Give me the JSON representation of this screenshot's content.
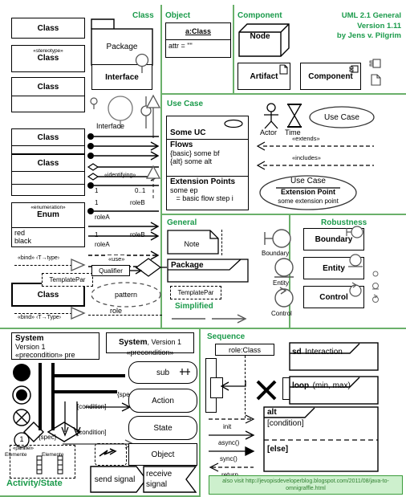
{
  "meta": {
    "title_line1": "UML 2.1 General",
    "title_line2": "Version 1.11",
    "title_line3": "by Jens v. Pilgrim",
    "accent_green": "#1a9a4a",
    "divider_green": "#6ab06a",
    "footer_text": "also visit http://jevopisdeveloperblog.blogspot.com/2011/08/java-to-omnigraffle.html"
  },
  "sections": {
    "class": {
      "label": "Class"
    },
    "object": {
      "label": "Object"
    },
    "component": {
      "label": "Component"
    },
    "use_case": {
      "label": "Use Case"
    },
    "general": {
      "label": "General"
    },
    "robustness": {
      "label": "Robustness"
    },
    "activity_state": {
      "label": "Activity/State"
    },
    "sequence": {
      "label": "Sequence"
    },
    "simplified": {
      "label": "Simplified"
    }
  },
  "class_section": {
    "shapes": [
      {
        "name": "class-simple",
        "title": "Class"
      },
      {
        "name": "class-stereotype",
        "stereotype": "«stereotype»",
        "title": "Class"
      },
      {
        "name": "class-two-compartment",
        "title": "Class"
      },
      {
        "name": "class-three-compartment",
        "title": "Class"
      },
      {
        "name": "class-four-compartment",
        "title": "Class"
      }
    ],
    "enum": {
      "stereotype": "«enumeration»",
      "title": "Enum",
      "literals": [
        "red",
        "black"
      ]
    },
    "package_label": "Package",
    "interface_box_label": "Interface",
    "interface_lollipop_label": "Interface",
    "bind_upper": "«bind» ‹T→type›",
    "bind_lower": "«bind» ‹T→Type›",
    "template_par": "TemplatePar",
    "class_template_title": "Class",
    "use_label": "«use»",
    "qualifier_label": "Qualifier",
    "pattern_label": "pattern",
    "role_label": "role",
    "associations": [
      {
        "name": "identifying",
        "label": "«identifying»",
        "mult_src": "1",
        "mult_tgt": "0..1"
      },
      {
        "name": "roleB-roleA-1",
        "mult_src": "1",
        "role_tgt": "roleB",
        "role_src": "roleA"
      },
      {
        "name": "roleB-roleA-2",
        "mult_src": "1",
        "role_tgt": "roleB",
        "role_src": "roleA"
      }
    ]
  },
  "object_section": {
    "instance_title": "a:Class",
    "attribute": "attr = \"\""
  },
  "component_section": {
    "node_label": "Node",
    "artifact_label": "Artifact",
    "component_label": "Component"
  },
  "use_case_section": {
    "uc_box": {
      "title": "Some UC",
      "flows_header": "Flows",
      "flows": [
        "{basic} some bf",
        "{alt} some alt"
      ],
      "ext_header": "Extension Points",
      "ext_lines": [
        "some ep",
        "   = basic flow step i"
      ]
    },
    "actor_label": "Actor",
    "time_label": "Time",
    "use_case_oval": "Use Case",
    "extends_label": "«extends»",
    "includes_label": "«includes»",
    "ext_oval": {
      "title": "Use Case",
      "sub": "Extension Point",
      "detail": "some extension point"
    }
  },
  "general_section": {
    "note_label": "Note",
    "package_label": "Package",
    "template_par": "TemplatePar"
  },
  "robustness_section": {
    "boundary_small": "Boundary",
    "entity_small": "Entity",
    "control_small": "Control",
    "boundary_box": "Boundary",
    "entity_box": "Entity",
    "control_box": "Control"
  },
  "activity_section": {
    "system_box": {
      "title": "System",
      "version": "Version 1",
      "precondition": "«precondition»  pre"
    },
    "system_inline": {
      "title": "System",
      "version": ", Version 1",
      "precondition": "«precondition»"
    },
    "sub_label": "sub",
    "action_label": "Action",
    "state_label": "State",
    "object_label": "Object",
    "send_signal_label": "send signal",
    "receive_signal_label": "receive\nsignal",
    "spec_label_1": "{spec}",
    "spec_label_2": "{spec}",
    "condition_label_1": "[condition]",
    "condition_label_2": "[condition]",
    "node_one": "1",
    "parallel_label": "«parallel»",
    "elements_left": "Elemente",
    "elements_right": "Elemente"
  },
  "sequence_section": {
    "lifeline_label": "role:Class",
    "sd_keyword": "sd",
    "sd_name": "Interaction",
    "loop_keyword": "loop",
    "loop_args": "(min, max)",
    "alt_keyword": "alt",
    "alt_condition": "[condition]",
    "alt_else": "[else]",
    "messages": [
      "init",
      "async()",
      "sync()",
      "return"
    ]
  }
}
